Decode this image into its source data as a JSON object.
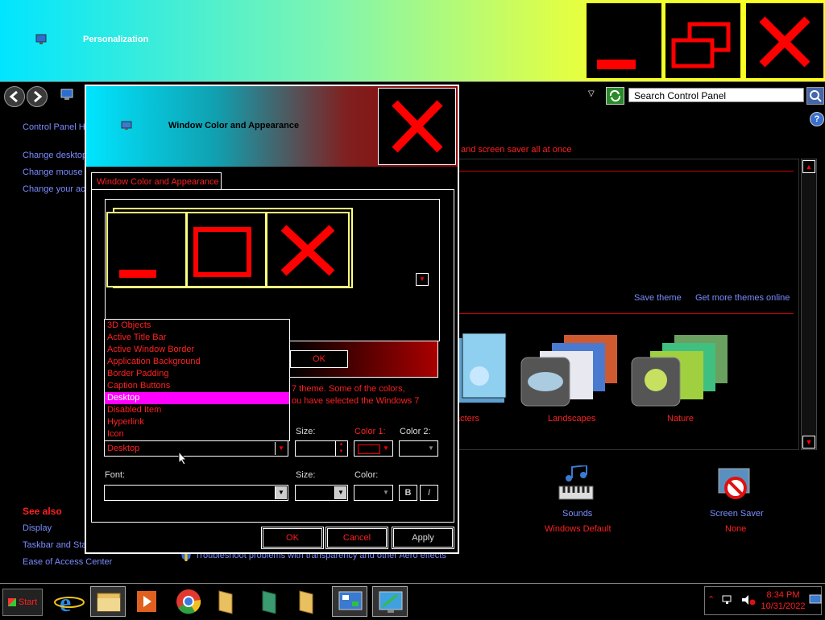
{
  "window": {
    "title": "Personalization"
  },
  "search": {
    "placeholder": "Search Control Panel"
  },
  "left_nav": {
    "items": [
      "Control Panel Ho",
      "Change desktop",
      "Change mouse p",
      "Change your ac"
    ],
    "see_also_title": "See also",
    "see_also": [
      "Display",
      "Taskbar and Sta",
      "Ease of Access Center"
    ]
  },
  "main": {
    "intro_fragment": "and screen saver all at once",
    "save_theme": "Save theme",
    "more_themes": "Get more themes online",
    "themes": [
      "acters",
      "Landscapes",
      "Nature"
    ],
    "bottom_items": [
      {
        "label": "Sounds",
        "sub": "Windows Default"
      },
      {
        "label": "Screen Saver",
        "sub": "None"
      }
    ],
    "troubleshoot": "Troubleshoot problems with transparency and other Aero effects"
  },
  "dialog": {
    "title": "Window Color and Appearance",
    "tab": "Window Color and Appearance",
    "preview_ok": "OK",
    "message_line1": "7 theme.  Some of the colors,",
    "message_line2": "ou have selected the Windows 7",
    "item_options": [
      "3D Objects",
      "Active Title Bar",
      "Active Window Border",
      "Application Background",
      "Border Padding",
      "Caption Buttons",
      "Desktop",
      "Disabled Item",
      "Hyperlink",
      "Icon"
    ],
    "selected_index": 6,
    "item_value": "Desktop",
    "size_label": "Size:",
    "color1_label": "Color 1:",
    "color2_label": "Color 2:",
    "font_label": "Font:",
    "font_size_label": "Size:",
    "font_color_label": "Color:",
    "bold_label": "B",
    "italic_label": "I",
    "ok": "OK",
    "cancel": "Cancel",
    "apply": "Apply"
  },
  "taskbar": {
    "start_label": "Start",
    "time": "8:34 PM",
    "date": "10/31/2022"
  },
  "colors": {
    "accent_red": "#ff0000",
    "link_blue": "#7b8cff",
    "highlight": "#ff00ff"
  }
}
